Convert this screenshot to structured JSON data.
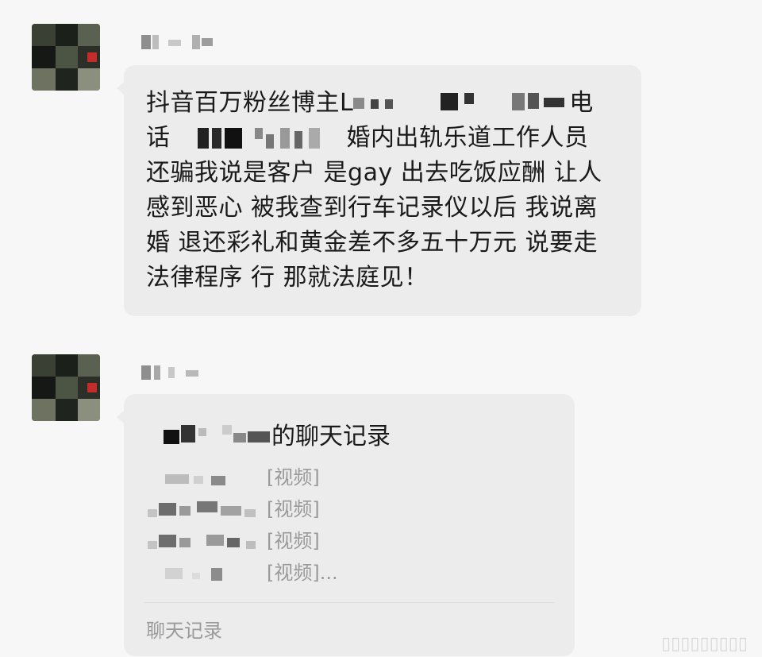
{
  "colors": {
    "background": "#f7f7f7",
    "bubble": "#ececec",
    "text": "#1a1a1a",
    "muted_text": "#9a9a9a"
  },
  "messages": [
    {
      "sender": "[redacted]",
      "avatar": "avatar-pixelated",
      "lines": [
        {
          "before": "抖音百万粉丝博主L",
          "after": "电"
        },
        {
          "before": "话",
          "after": "婚内出轨乐道工作人员"
        },
        {
          "text": "还骗我说是客户 是gay 出去吃饭应酬 让人"
        },
        {
          "text": "感到恶心 被我查到行车记录仪以后 我说离"
        },
        {
          "text": "婚 退还彩礼和黄金差不多五十万元 说要走"
        },
        {
          "text": "法律程序 行 那就法庭见！"
        }
      ]
    },
    {
      "sender": "[redacted]",
      "avatar": "avatar-pixelated",
      "chat_record": {
        "title_suffix": "的聊天记录",
        "items": [
          {
            "content": "[视频]"
          },
          {
            "content": "[视频]"
          },
          {
            "content": "[视频]"
          },
          {
            "content": "[视频]..."
          }
        ],
        "footer": "聊天记录"
      }
    }
  ]
}
